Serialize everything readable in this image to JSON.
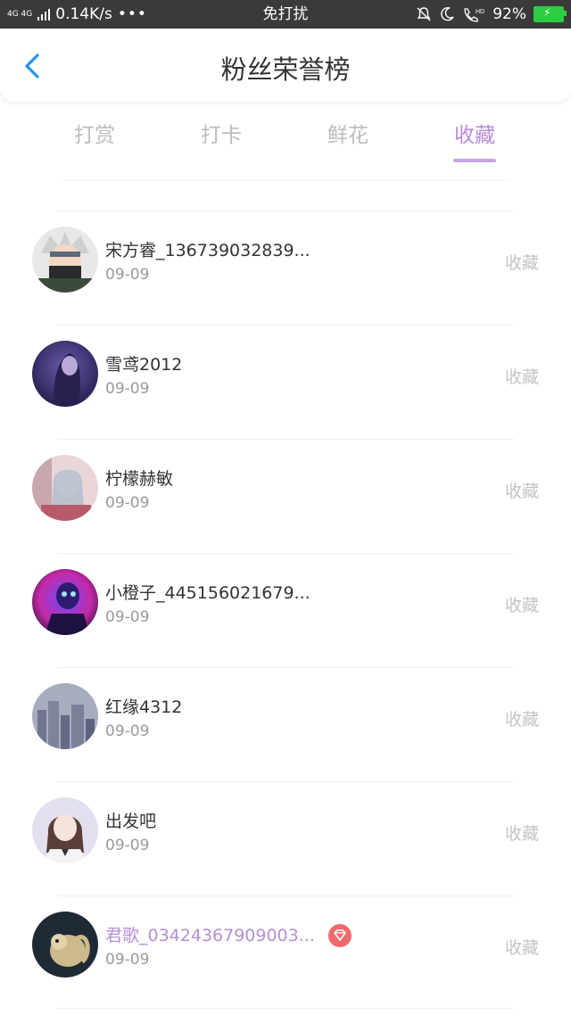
{
  "status_bar": {
    "network": "4G 4G",
    "speed": "0.14K/s",
    "dots": "•••",
    "mode": "免打扰",
    "battery": "92%"
  },
  "header": {
    "title": "粉丝荣誉榜"
  },
  "tabs": [
    {
      "label": "打赏",
      "active": false
    },
    {
      "label": "打卡",
      "active": false
    },
    {
      "label": "鲜花",
      "active": false
    },
    {
      "label": "收藏",
      "active": true
    }
  ],
  "colors": {
    "accent": "#b789dc",
    "vip_name": "#b48fd6",
    "badge": "#ef6b6b"
  },
  "fans": [
    {
      "name": "宋方睿_136739032839...",
      "date": "09-09",
      "action": "收藏",
      "avatar_icon": "masked-ninja-avatar"
    },
    {
      "name": "雪鸢2012",
      "date": "09-09",
      "action": "收藏",
      "avatar_icon": "dark-purple-portrait-avatar"
    },
    {
      "name": "柠檬赫敏",
      "date": "09-09",
      "action": "收藏",
      "avatar_icon": "anime-girl-avatar"
    },
    {
      "name": "小橙子_445156021679...",
      "date": "09-09",
      "action": "收藏",
      "avatar_icon": "neon-purple-avatar"
    },
    {
      "name": "红缘4312",
      "date": "09-09",
      "action": "收藏",
      "avatar_icon": "city-skyline-avatar"
    },
    {
      "name": "出发吧",
      "date": "09-09",
      "action": "收藏",
      "avatar_icon": "girl-portrait-avatar"
    },
    {
      "name": "君歌_03424367909003...",
      "date": "09-09",
      "action": "收藏",
      "avatar_icon": "monkey-avatar",
      "vip": true
    }
  ]
}
